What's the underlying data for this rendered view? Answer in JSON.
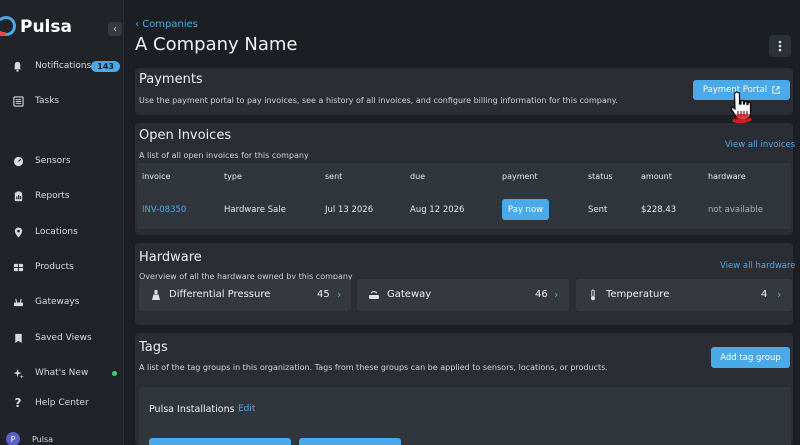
{
  "app": {
    "name": "Pulsa"
  },
  "sidebar": {
    "collapse_icon": "chevron-left-icon",
    "items": [
      {
        "label": "Notifications",
        "icon": "bell-icon",
        "badge": "143"
      },
      {
        "label": "Tasks",
        "icon": "list-icon"
      },
      {
        "label": "Sensors",
        "icon": "gauge-icon"
      },
      {
        "label": "Reports",
        "icon": "report-icon"
      },
      {
        "label": "Locations",
        "icon": "pin-icon"
      },
      {
        "label": "Products",
        "icon": "grid-icon"
      },
      {
        "label": "Gateways",
        "icon": "router-icon"
      },
      {
        "label": "Saved Views",
        "icon": "bookmark-icon"
      },
      {
        "label": "What's New",
        "icon": "sparkle-icon",
        "dot_color": "#3ccf6b"
      },
      {
        "label": "Help Center",
        "icon": "question-icon"
      }
    ],
    "user": {
      "initial": "P",
      "name": "Pulsa"
    }
  },
  "header": {
    "breadcrumb": "Companies",
    "title": "A Company Name"
  },
  "payments": {
    "title": "Payments",
    "description": "Use the payment portal to pay invoices, see a history of all invoices, and configure billing information for this company.",
    "portal_button": "Payment Portal"
  },
  "invoices": {
    "title": "Open Invoices",
    "description": "A list of all open invoices for this company",
    "view_all": "View all invoices",
    "columns": [
      "invoice",
      "type",
      "sent",
      "due",
      "payment",
      "status",
      "amount",
      "hardware"
    ],
    "rows": [
      {
        "invoice": "INV-08350",
        "type": "Hardware Sale",
        "sent": "Jul 13 2026",
        "due": "Aug 12 2026",
        "payment": "Pay now",
        "status": "Sent",
        "amount": "$228.43",
        "hardware": "not available"
      }
    ]
  },
  "hardware": {
    "title": "Hardware",
    "description": "Overview of all the hardware owned by this company",
    "view_all": "View all hardware",
    "items": [
      {
        "name": "Differential Pressure",
        "count": "45",
        "icon": "pressure-icon"
      },
      {
        "name": "Gateway",
        "count": "46",
        "icon": "gateway-icon"
      },
      {
        "name": "Temperature",
        "count": "4",
        "icon": "thermometer-icon"
      }
    ]
  },
  "tags": {
    "title": "Tags",
    "description": "A list of the tag groups in this organization. Tags from these groups can be applied to sensors, locations, or products.",
    "add_button": "Add tag group",
    "groups": [
      {
        "name": "Pulsa Installations",
        "edit": "Edit"
      }
    ]
  },
  "colors": {
    "accent": "#4aa9e8",
    "background": "#1b1e23",
    "card": "#2a2d33",
    "logo_red": "#e84a4a"
  }
}
